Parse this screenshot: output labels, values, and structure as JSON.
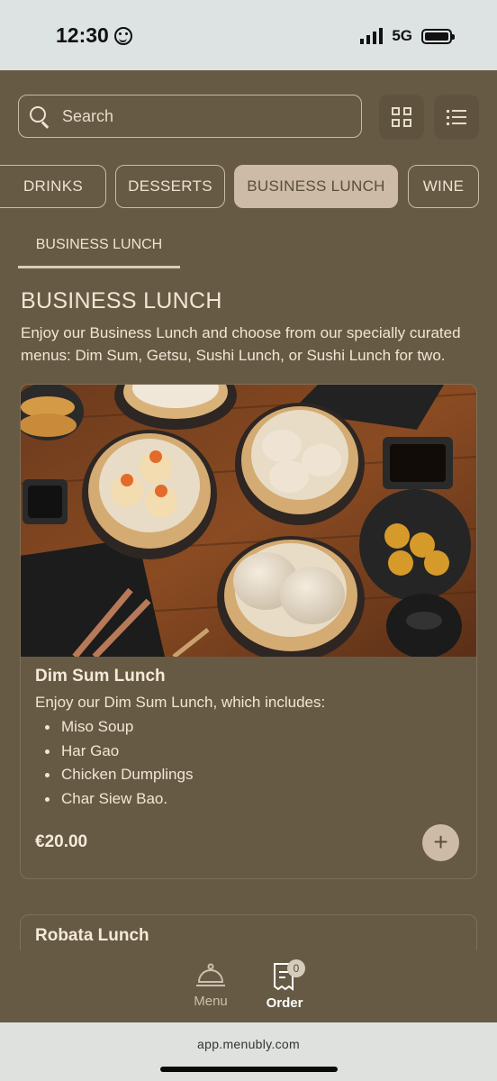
{
  "status_bar": {
    "time": "12:30",
    "network": "5G"
  },
  "search": {
    "placeholder": "Search"
  },
  "categories": [
    {
      "label": "DRINKS",
      "active": false
    },
    {
      "label": "DESSERTS",
      "active": false
    },
    {
      "label": "BUSINESS LUNCH",
      "active": true
    },
    {
      "label": "WINE",
      "active": false
    }
  ],
  "subtab": {
    "label": "BUSINESS LUNCH"
  },
  "section": {
    "title": "BUSINESS LUNCH",
    "description": "Enjoy our Business Lunch and choose from our specially curated menus: Dim Sum, Getsu, Sushi Lunch, or Sushi Lunch for two."
  },
  "items": [
    {
      "title": "Dim Sum Lunch",
      "description": "Enjoy our Dim Sum Lunch, which includes:",
      "includes": [
        "Miso Soup",
        "Har Gao",
        "Chicken Dumplings",
        "Char Siew Bao."
      ],
      "price": "€20.00",
      "add_label": "+"
    },
    {
      "title": "Robata Lunch"
    }
  ],
  "bottom_nav": {
    "menu_label": "Menu",
    "order_label": "Order",
    "order_count": "0"
  },
  "browser": {
    "url": "app.menubly.com"
  },
  "colors": {
    "background": "#675a44",
    "accent": "#cdbba7",
    "text": "#f0e6d6"
  }
}
